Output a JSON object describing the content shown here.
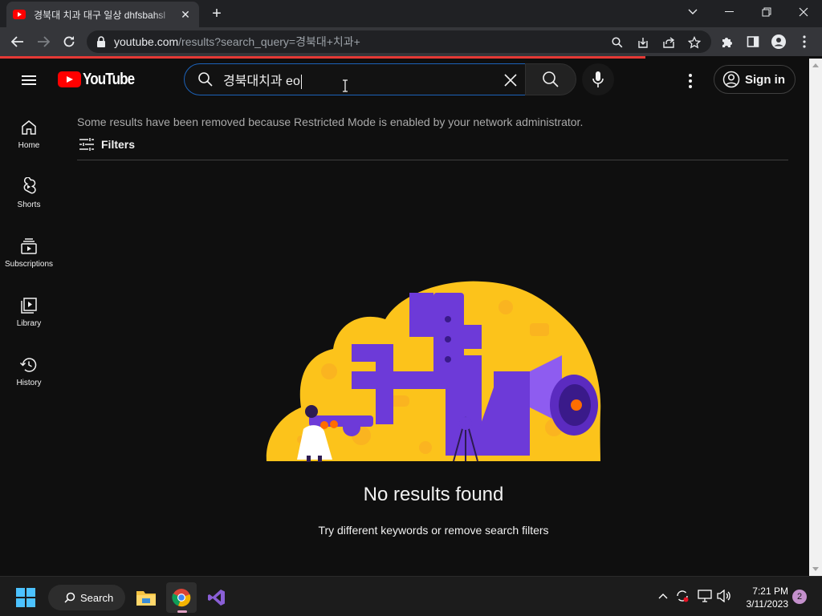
{
  "browser": {
    "tab_title": "경북대 치과 대구 일상 dhfsbahsl",
    "tab_close": "✕",
    "new_tab": "+",
    "url_domain": "youtube.com",
    "url_rest": "/results?search_query=경북대+치과+"
  },
  "header": {
    "logo_text": "YouTube",
    "search_value": "경북대치과 eo",
    "signin_label": "Sign in"
  },
  "guide": {
    "items": [
      {
        "label": "Home",
        "icon": "home-icon"
      },
      {
        "label": "Shorts",
        "icon": "shorts-icon"
      },
      {
        "label": "Subscriptions",
        "icon": "subscriptions-icon"
      },
      {
        "label": "Library",
        "icon": "library-icon"
      },
      {
        "label": "History",
        "icon": "history-icon"
      }
    ]
  },
  "main": {
    "notice": "Some results have been removed because Restricted Mode is enabled by your network administrator.",
    "filters_label": "Filters",
    "empty_title": "No results found",
    "empty_subtitle": "Try different keywords or remove search filters"
  },
  "taskbar": {
    "search_label": "Search",
    "time": "7:21 PM",
    "date": "3/11/2023",
    "notification_count": "2"
  },
  "colors": {
    "yt_background": "#0f0f0f",
    "yt_red": "#ff0000",
    "search_focus_border": "#1c62b9",
    "illustration_yellow": "#fcc31b",
    "illustration_purple": "#6d3ad8",
    "loading_bar": "#e53935"
  }
}
